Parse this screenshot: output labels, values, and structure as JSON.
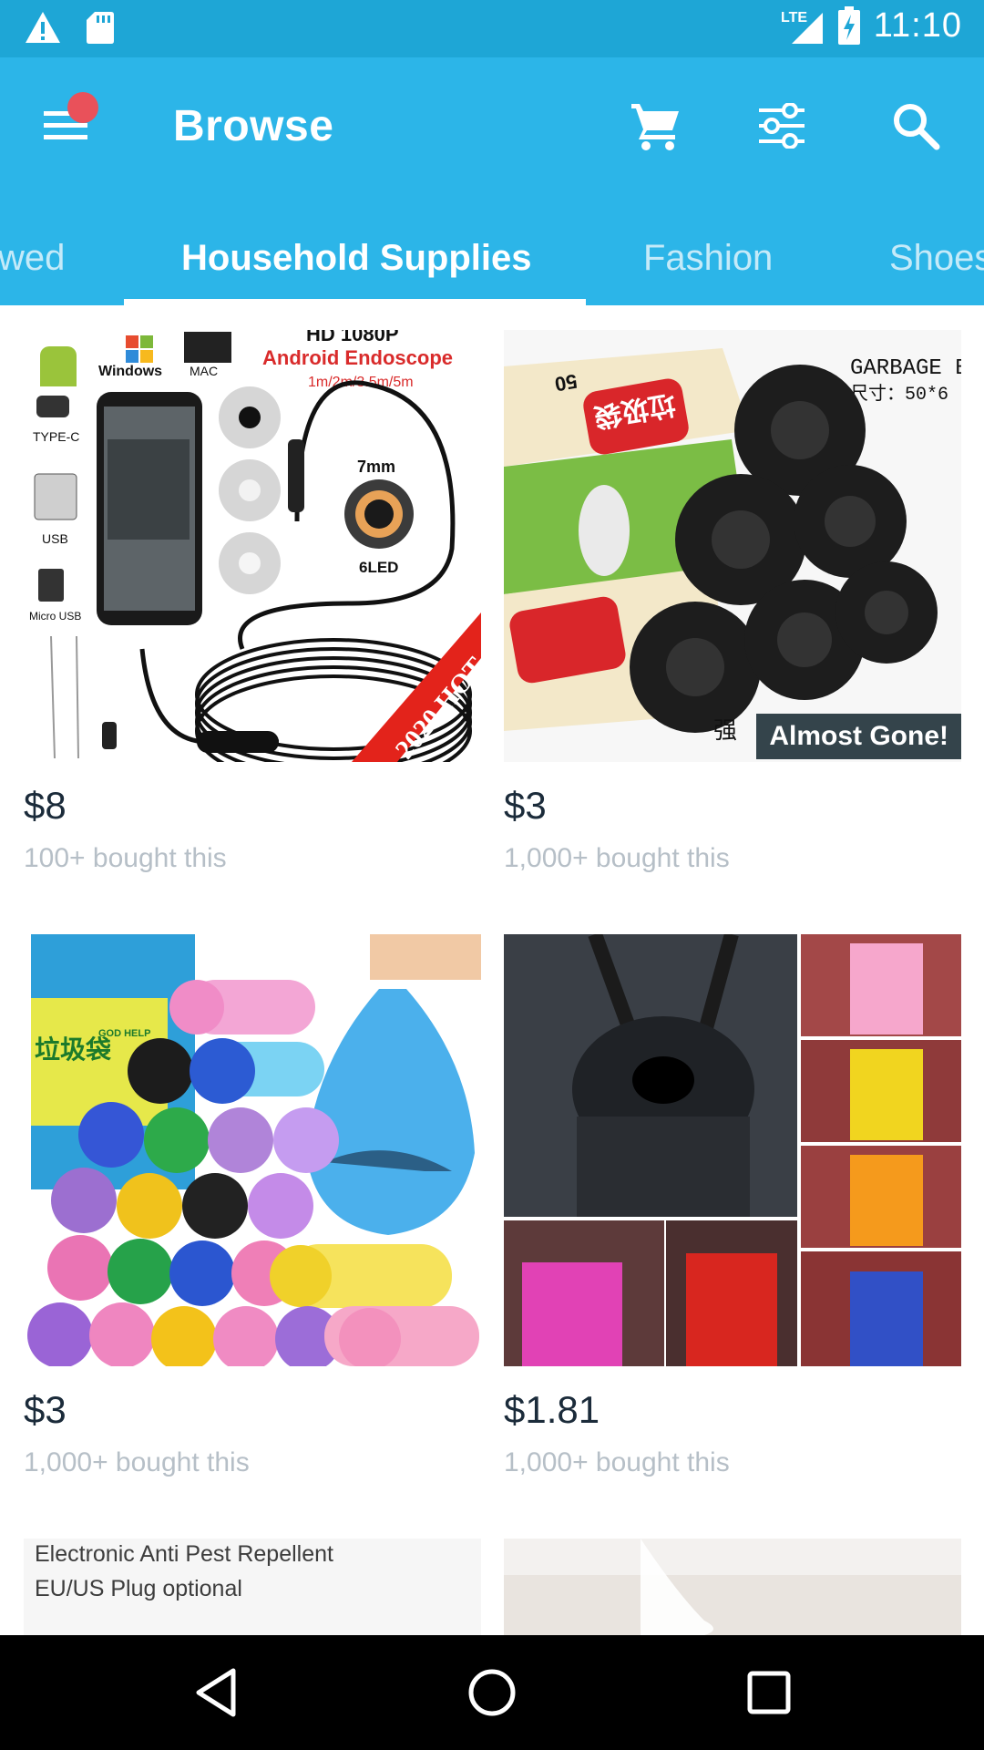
{
  "status_bar": {
    "time": "11:10",
    "network": "LTE",
    "icons": [
      "warning-icon",
      "sd-card-icon",
      "signal-icon",
      "battery-charging-icon"
    ]
  },
  "app_bar": {
    "title": "Browse",
    "actions": [
      "cart-icon",
      "filter-icon",
      "search-icon"
    ]
  },
  "tabs": [
    {
      "label": "wed"
    },
    {
      "label": "Household Supplies",
      "active": true
    },
    {
      "label": "Fashion"
    },
    {
      "label": "Shoes"
    }
  ],
  "products": [
    {
      "price": "$8",
      "bought": "100+ bought this",
      "image_text": {
        "title1": "HD 1080P",
        "title2": "Android Endoscope",
        "sizes": "1m/2m/3.5m/5m",
        "mm": "7mm",
        "led": "6LED",
        "ribbon": "2020 HOT",
        "windows": "Windows",
        "mac": "MAC",
        "typec": "TYPE-C",
        "usb": "USB",
        "micro": "Micro USB"
      }
    },
    {
      "price": "$3",
      "bought": "1,000+ bought this",
      "badge": "Almost Gone!",
      "image_text": {
        "garbage": "GARBAGE B",
        "size": "尺寸：50*6",
        "cn": "垃圾袋",
        "fifty": "50",
        "strong": "强"
      }
    },
    {
      "price": "$3",
      "bought": "1,000+ bought this",
      "image_text": {
        "cn": "垃圾袋",
        "god_help": "GOD HELP"
      }
    },
    {
      "price": "$1.81",
      "bought": "1,000+ bought this"
    },
    {
      "caption_line1": "Electronic Anti Pest Repellent",
      "caption_line2": "EU/US Plug optional"
    },
    {}
  ]
}
